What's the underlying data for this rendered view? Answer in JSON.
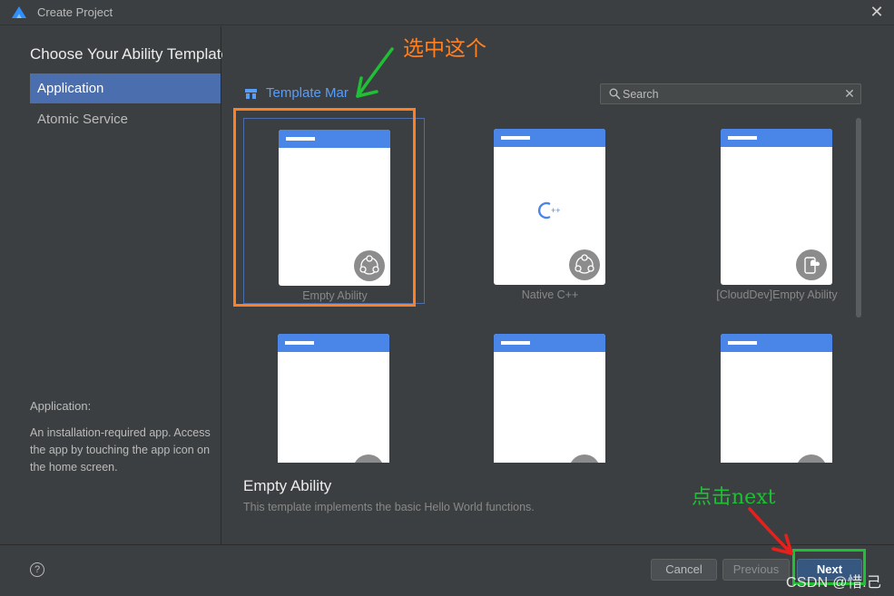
{
  "window": {
    "title": "Create Project",
    "logo_icon": "harmonyos-logo-icon",
    "close_icon": "close-icon",
    "close_glyph": "✕"
  },
  "sidebar": {
    "heading": "Choose Your Ability Template",
    "items": [
      {
        "label": "Application",
        "active": true
      },
      {
        "label": "Atomic Service",
        "active": false
      }
    ],
    "description_title": "Application:",
    "description_body": "An installation-required app. Access the app by touching the app icon on the home screen."
  },
  "main": {
    "section_label": "Template Mar",
    "section_icon": "template-market-icon",
    "search": {
      "placeholder": "Search",
      "value": "",
      "icon": "search-icon",
      "clear_icon": "clear-icon",
      "clear_glyph": "✕"
    },
    "templates": [
      {
        "label": "Empty Ability",
        "badge_icon": "ability-nodes-icon",
        "selected": true
      },
      {
        "label": "Native C++",
        "badge_icon": "ability-nodes-icon",
        "selected": false
      },
      {
        "label": "[CloudDev]Empty Ability",
        "badge_icon": "cloud-device-icon",
        "selected": false
      },
      {
        "label": "",
        "badge_icon": "template-badge-icon",
        "selected": false
      },
      {
        "label": "",
        "badge_icon": "template-badge-icon",
        "selected": false
      },
      {
        "label": "",
        "badge_icon": "template-badge-icon",
        "selected": false
      }
    ],
    "selected_title": "Empty Ability",
    "selected_description": "This template implements the basic Hello World functions."
  },
  "footer": {
    "help_glyph": "?",
    "cancel": "Cancel",
    "previous": "Previous",
    "next": "Next"
  },
  "annotations": {
    "select_note": "选中这个",
    "click_note": "点击next",
    "watermark": "CSDN @惜.己"
  },
  "colors": {
    "accent": "#4b6eaf",
    "link": "#589df6",
    "card_header": "#4a86e8",
    "annotation_orange": "#ff8022",
    "annotation_green": "#1fbf36",
    "annotation_red": "#e8201c",
    "background": "#3c3f41"
  }
}
